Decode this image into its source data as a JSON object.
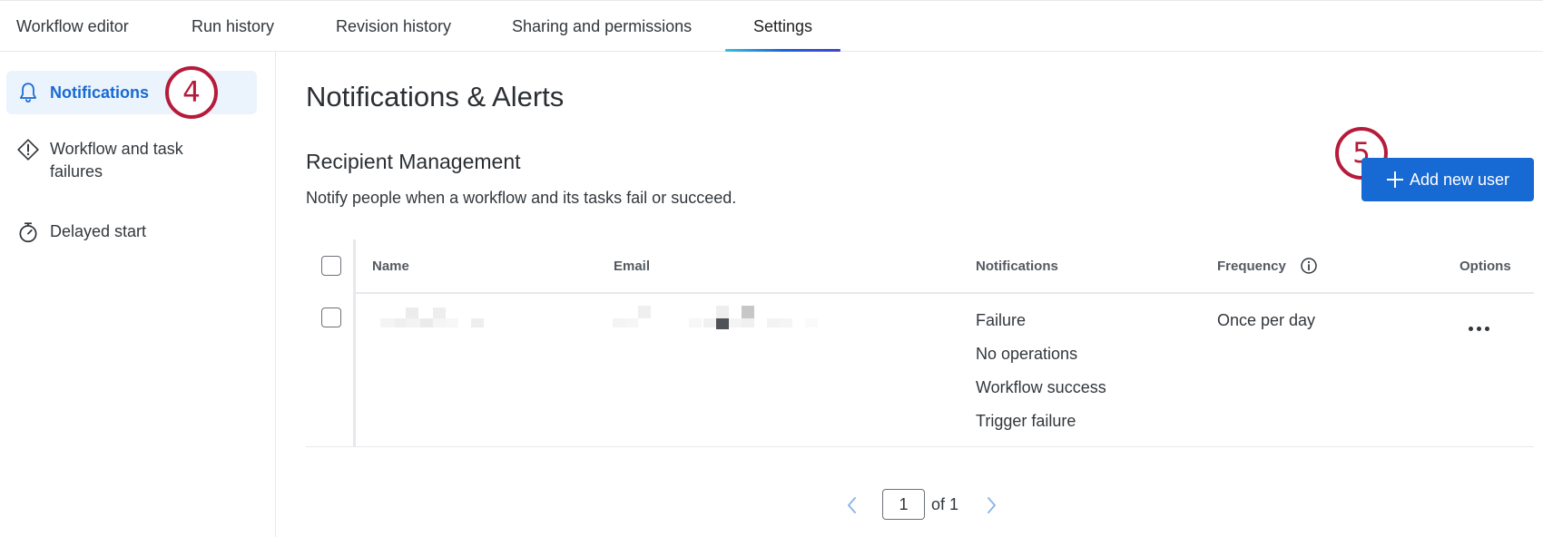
{
  "tabs": [
    {
      "label": "Workflow editor"
    },
    {
      "label": "Run history"
    },
    {
      "label": "Revision history"
    },
    {
      "label": "Sharing and permissions"
    },
    {
      "label": "Settings",
      "active": true
    }
  ],
  "sidebar": {
    "items": [
      {
        "label": "Notifications",
        "icon": "bell-icon",
        "active": true
      },
      {
        "label": "Workflow and task\nfailures",
        "icon": "warning-diamond-icon"
      },
      {
        "label": "Delayed start",
        "icon": "stopwatch-icon"
      }
    ]
  },
  "callouts": {
    "step4": "4",
    "step5": "5"
  },
  "main": {
    "title": "Notifications & Alerts",
    "section_title": "Recipient Management",
    "section_desc": "Notify people when a workflow and its tasks fail or succeed.",
    "add_button_label": "Add new user"
  },
  "table": {
    "headers": {
      "name": "Name",
      "email": "Email",
      "notifications": "Notifications",
      "frequency": "Frequency",
      "options": "Options"
    },
    "rows": [
      {
        "notifications": [
          "Failure",
          "No operations",
          "Workflow success",
          "Trigger failure"
        ],
        "frequency": "Once per day"
      }
    ]
  },
  "pagination": {
    "current": "1",
    "of_label": "of 1"
  },
  "colors": {
    "accent": "#1769d3",
    "callout": "#b51b3a",
    "active_bg": "#ebf3fd"
  }
}
